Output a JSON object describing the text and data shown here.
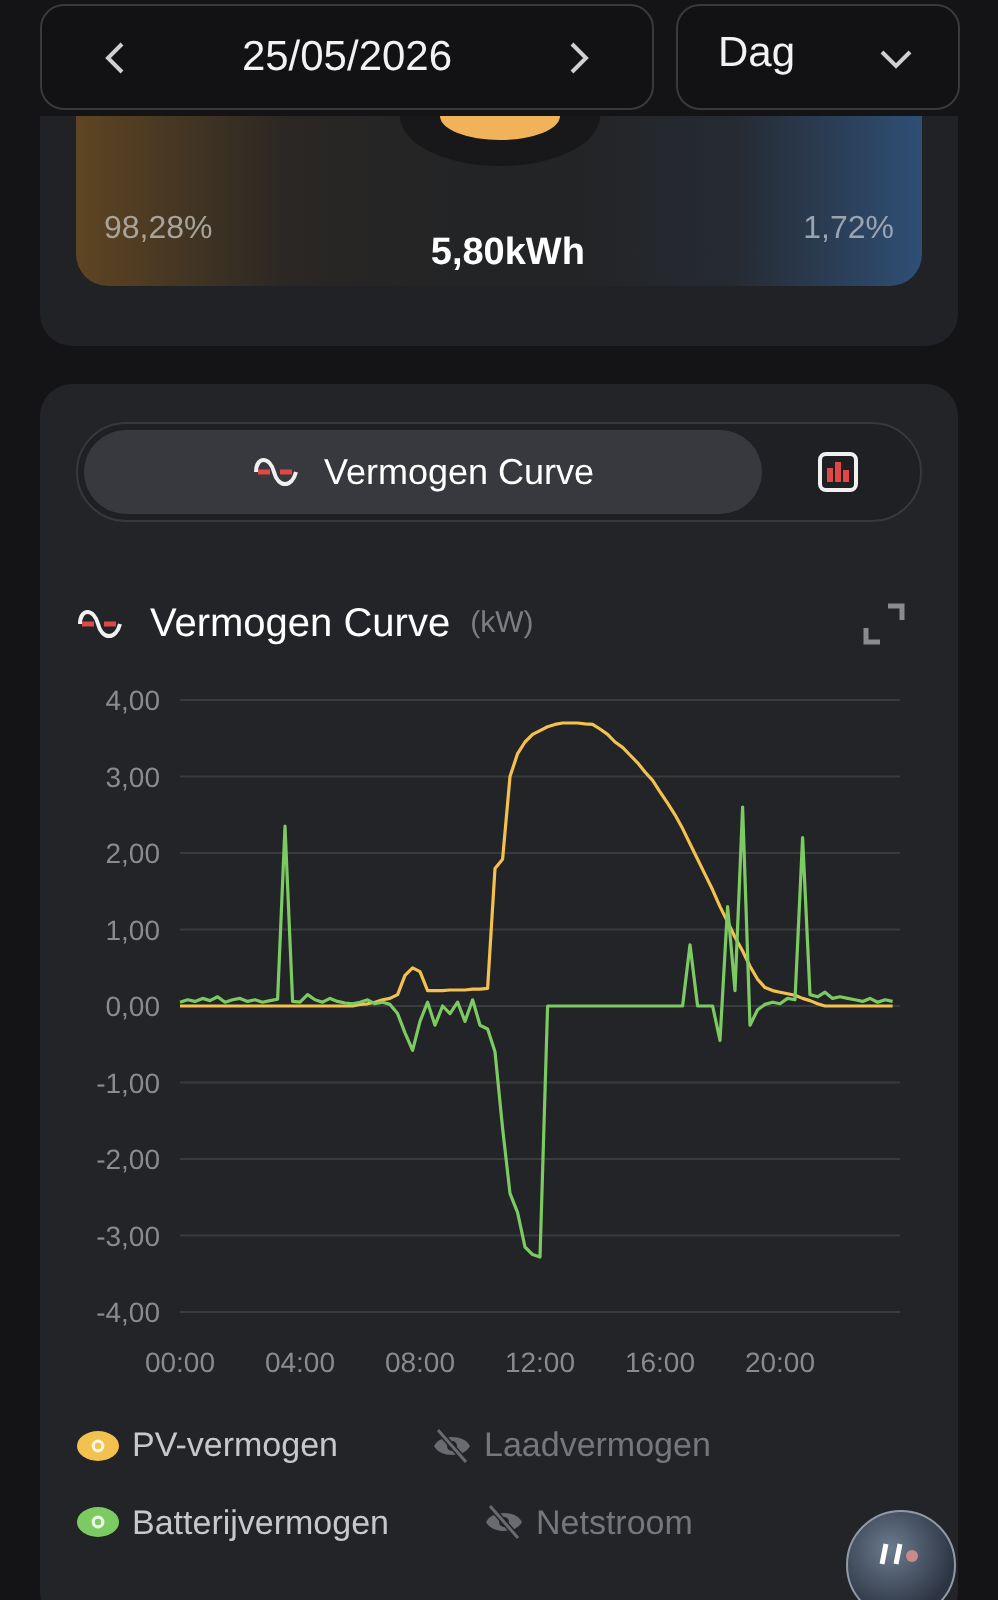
{
  "date_nav": {
    "date": "25/05/2026"
  },
  "period_select": {
    "value": "Dag"
  },
  "summary": {
    "left_percent": "98,28%",
    "total": "5,80kWh",
    "right_percent": "1,72%"
  },
  "view_tabs": [
    {
      "kind": "curve",
      "label": "Vermogen Curve",
      "selected": true
    },
    {
      "kind": "bars",
      "selected": false
    }
  ],
  "chart_panel": {
    "title": "Vermogen Curve",
    "unit": "(kW)",
    "chart_data": {
      "type": "line",
      "x": [
        0,
        0.25,
        0.5,
        0.75,
        1,
        1.25,
        1.5,
        1.75,
        2,
        2.25,
        2.5,
        2.75,
        3,
        3.25,
        3.5,
        3.75,
        4,
        4.25,
        4.5,
        4.75,
        5,
        5.25,
        5.5,
        5.75,
        6,
        6.25,
        6.5,
        6.75,
        7,
        7.25,
        7.5,
        7.75,
        8,
        8.25,
        8.5,
        8.75,
        9,
        9.25,
        9.5,
        9.75,
        10,
        10.25,
        10.5,
        10.75,
        11,
        11.25,
        11.5,
        11.75,
        12,
        12.25,
        12.5,
        12.75,
        13,
        13.25,
        13.5,
        13.75,
        14,
        14.25,
        14.5,
        14.75,
        15,
        15.25,
        15.5,
        15.75,
        16,
        16.25,
        16.5,
        16.75,
        17,
        17.25,
        17.5,
        17.75,
        18,
        18.25,
        18.5,
        18.75,
        19,
        19.25,
        19.5,
        19.75,
        20,
        20.25,
        20.5,
        20.75,
        21,
        21.25,
        21.5,
        21.75,
        22,
        22.25,
        22.5,
        22.75,
        23,
        23.25,
        23.5,
        23.75
      ],
      "series": [
        {
          "name": "PV-vermogen",
          "color": "#f2c14e",
          "values": [
            0,
            0,
            0,
            0,
            0,
            0,
            0,
            0,
            0,
            0,
            0,
            0,
            0,
            0,
            0,
            0,
            0,
            0,
            0,
            0,
            0,
            0,
            0,
            0,
            0.02,
            0.03,
            0.05,
            0.08,
            0.1,
            0.15,
            0.4,
            0.5,
            0.45,
            0.2,
            0.2,
            0.2,
            0.21,
            0.21,
            0.21,
            0.22,
            0.22,
            0.23,
            1.8,
            1.92,
            3.0,
            3.3,
            3.45,
            3.55,
            3.6,
            3.65,
            3.68,
            3.7,
            3.7,
            3.7,
            3.69,
            3.68,
            3.62,
            3.55,
            3.45,
            3.38,
            3.28,
            3.18,
            3.06,
            2.95,
            2.8,
            2.65,
            2.5,
            2.32,
            2.12,
            1.92,
            1.72,
            1.52,
            1.3,
            1.1,
            0.9,
            0.72,
            0.52,
            0.35,
            0.24,
            0.2,
            0.18,
            0.16,
            0.14,
            0.1,
            0.07,
            0.03,
            0,
            0,
            0,
            0,
            0,
            0,
            0,
            0,
            0,
            0
          ]
        },
        {
          "name": "Batterijvermogen",
          "color": "#7ccb62",
          "values": [
            0.05,
            0.08,
            0.06,
            0.1,
            0.07,
            0.12,
            0.05,
            0.08,
            0.1,
            0.06,
            0.08,
            0.05,
            0.07,
            0.09,
            2.35,
            0.06,
            0.05,
            0.15,
            0.08,
            0.05,
            0.1,
            0.06,
            0.04,
            0.03,
            0.05,
            0.08,
            0.03,
            0.05,
            0.02,
            -0.1,
            -0.35,
            -0.58,
            -0.2,
            0.05,
            -0.25,
            0,
            -0.1,
            0.05,
            -0.2,
            0.08,
            -0.25,
            -0.3,
            -0.6,
            -1.6,
            -2.45,
            -2.7,
            -3.15,
            -3.25,
            -3.28,
            0,
            0,
            0,
            0,
            0,
            0,
            0,
            0,
            0,
            0,
            0,
            0,
            0,
            0,
            0,
            0,
            0,
            0,
            0,
            0.8,
            0,
            0,
            0,
            -0.45,
            1.3,
            0.2,
            2.6,
            -0.25,
            -0.05,
            0.02,
            0.05,
            0.03,
            0.1,
            0.08,
            2.2,
            0.15,
            0.12,
            0.18,
            0.1,
            0.12,
            0.1,
            0.08,
            0.06,
            0.1,
            0.05,
            0.08,
            0.06
          ]
        }
      ],
      "xlim": [
        0,
        24
      ],
      "ylim": [
        -4,
        4
      ],
      "grid": true,
      "xticks": [
        {
          "value": 0,
          "label": "00:00"
        },
        {
          "value": 4,
          "label": "04:00"
        },
        {
          "value": 8,
          "label": "08:00"
        },
        {
          "value": 12,
          "label": "12:00"
        },
        {
          "value": 16,
          "label": "16:00"
        },
        {
          "value": 20,
          "label": "20:00"
        }
      ],
      "yticks": [
        {
          "value": 4,
          "label": "4,00"
        },
        {
          "value": 3,
          "label": "3,00"
        },
        {
          "value": 2,
          "label": "2,00"
        },
        {
          "value": 1,
          "label": "1,00"
        },
        {
          "value": 0,
          "label": "0,00"
        },
        {
          "value": -1,
          "label": "-1,00"
        },
        {
          "value": -2,
          "label": "-2,00"
        },
        {
          "value": -3,
          "label": "-3,00"
        },
        {
          "value": -4,
          "label": "-4,00"
        }
      ]
    }
  },
  "legend": [
    {
      "visible": true
    },
    {
      "label": "Laadvermogen",
      "visible": false
    },
    {
      "visible": true
    },
    {
      "label": "Netstroom",
      "visible": false
    }
  ]
}
